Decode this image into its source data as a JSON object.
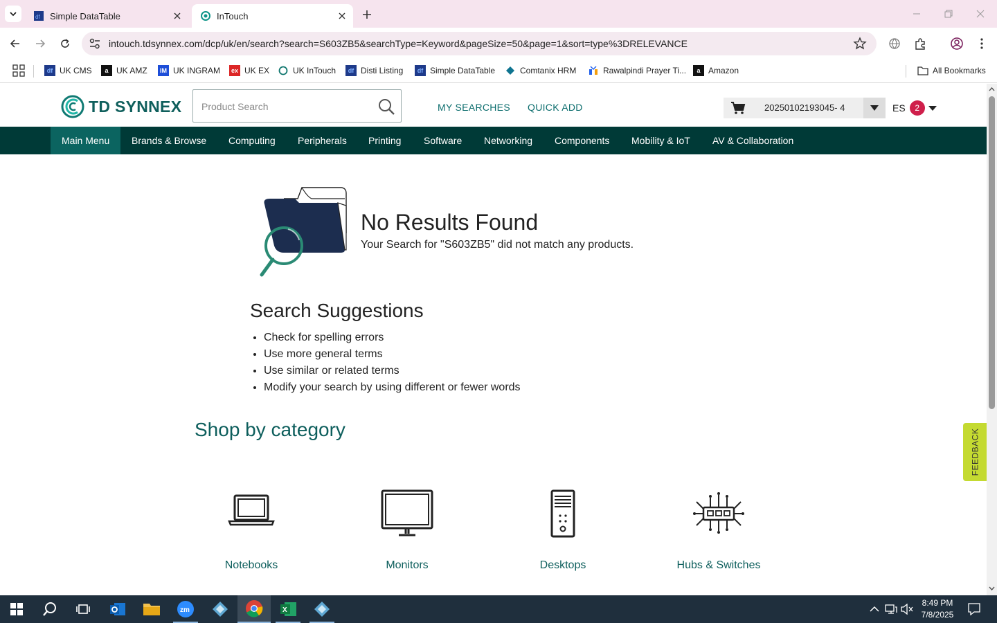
{
  "browser": {
    "tabs": [
      {
        "title": "Simple DataTable",
        "active": false,
        "favicon": "df-icon"
      },
      {
        "title": "InTouch",
        "active": true,
        "favicon": "intouch-icon"
      }
    ],
    "url": "intouch.tdsynnex.com/dcp/uk/en/search?search=S603ZB5&searchType=Keyword&pageSize=50&page=1&sort=type%3DRELEVANCE",
    "bookmarks": [
      {
        "label": "UK CMS",
        "icon": "df-icon",
        "color": "#1e3a8a"
      },
      {
        "label": "UK AMZ",
        "icon": "amazon-icon",
        "color": "#111111"
      },
      {
        "label": "UK INGRAM",
        "icon": "im-icon",
        "color": "#1d4ed8"
      },
      {
        "label": "UK EX",
        "icon": "ex-icon",
        "color": "#dc2626"
      },
      {
        "label": "UK InTouch",
        "icon": "intouch-icon",
        "color": "#0f766e"
      },
      {
        "label": "Disti Listing",
        "icon": "df-icon",
        "color": "#1e3a8a"
      },
      {
        "label": "Simple DataTable",
        "icon": "df-icon",
        "color": "#1e3a8a"
      },
      {
        "label": "Comtanix HRM",
        "icon": "comtanix-icon",
        "color": "#0e7490"
      },
      {
        "label": "Rawalpindi Prayer Ti...",
        "icon": "prayer-icon",
        "color": "#2563eb"
      },
      {
        "label": "Amazon",
        "icon": "amazon-icon",
        "color": "#111111"
      }
    ],
    "all_bookmarks": "All Bookmarks"
  },
  "header": {
    "brand": "TD SYNNEX",
    "search_placeholder": "Product Search",
    "links": [
      "MY SEARCHES",
      "QUICK ADD"
    ],
    "cart_number": "20250102193045- 4",
    "account": "ES",
    "badge": "2"
  },
  "nav": [
    "Main Menu",
    "Brands & Browse",
    "Computing",
    "Peripherals",
    "Printing",
    "Software",
    "Networking",
    "Components",
    "Mobility & IoT",
    "AV & Collaboration"
  ],
  "results": {
    "title": "No Results Found",
    "message": "Your Search for \"S603ZB5\" did not match any products."
  },
  "suggestions": {
    "title": "Search Suggestions",
    "items": [
      "Check for spelling errors",
      "Use more general terms",
      "Use similar or related terms",
      "Modify your search by using different or fewer words"
    ]
  },
  "shop": {
    "title": "Shop by category",
    "categories": [
      {
        "label": "Notebooks",
        "icon": "notebook-icon"
      },
      {
        "label": "Monitors",
        "icon": "monitor-icon"
      },
      {
        "label": "Desktops",
        "icon": "desktop-tower-icon"
      },
      {
        "label": "Hubs & Switches",
        "icon": "network-hub-icon"
      }
    ]
  },
  "feedback": "FEEDBACK",
  "taskbar": {
    "time": "8:49 PM",
    "date": "7/8/2025",
    "apps": [
      "start-icon",
      "search-icon",
      "task-view-icon",
      "outlook-icon",
      "file-explorer-icon",
      "zoom-icon",
      "app-diamond-icon",
      "chrome-icon",
      "excel-icon",
      "app-diamond-icon"
    ]
  },
  "colors": {
    "brand_teal": "#0f5f5c",
    "nav_bg": "#003a37",
    "nav_active": "#0b6460",
    "badge": "#cf1f4b",
    "feedback": "#c4da31",
    "tabbar": "#f6e4ee"
  }
}
